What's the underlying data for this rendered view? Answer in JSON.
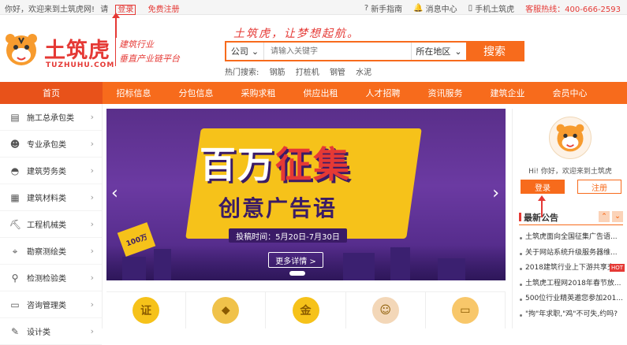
{
  "topbar": {
    "welcome": "你好，欢迎来到土筑虎网!",
    "please": "请",
    "login": "登录",
    "register": "免费注册",
    "guide": "新手指南",
    "messages": "消息中心",
    "mobile": "手机土筑虎",
    "hotline": "客服热线：400-666-2593"
  },
  "header": {
    "logo_text": "土筑虎",
    "logo_url": "TUZHUHU.COM",
    "slogan_line1": "建筑行业",
    "slogan_line2": "垂直产业链平台",
    "tagline": "土筑虎，让梦想起航。"
  },
  "search": {
    "type": "公司",
    "placeholder": "请输入关键字",
    "region": "所在地区",
    "button": "搜索",
    "hot_label": "热门搜索:",
    "hot_words": [
      "钢筋",
      "打桩机",
      "钢管",
      "水泥"
    ]
  },
  "nav": [
    "首页",
    "招标信息",
    "分包信息",
    "采购求租",
    "供应出租",
    "人才招聘",
    "资讯服务",
    "建筑企业",
    "会员中心"
  ],
  "sidebar": [
    {
      "label": "施工总承包类",
      "icon": "document-icon"
    },
    {
      "label": "专业承包类",
      "icon": "worker-icon"
    },
    {
      "label": "建筑劳务类",
      "icon": "helmet-icon"
    },
    {
      "label": "建筑材料类",
      "icon": "brick-icon"
    },
    {
      "label": "工程机械类",
      "icon": "excavator-icon"
    },
    {
      "label": "勘察测绘类",
      "icon": "survey-icon"
    },
    {
      "label": "检测检验类",
      "icon": "microscope-icon"
    },
    {
      "label": "咨询管理类",
      "icon": "chat-icon"
    },
    {
      "label": "设计类",
      "icon": "design-icon"
    }
  ],
  "banner": {
    "title_part1": "百万",
    "title_part2": "征集",
    "subtitle": "创意广告语",
    "time": "投稿时间：5月20日-7月30日",
    "more": "更多详情 >",
    "badge": "100万"
  },
  "features": [
    "证",
    "",
    "金",
    "",
    ""
  ],
  "user_panel": {
    "welcome": "Hi! 你好，欢迎来到土筑虎",
    "login": "登录",
    "register": "注册"
  },
  "notices": {
    "title": "最新公告",
    "items": [
      {
        "text": "土筑虎面向全国征集广告语...",
        "hot": false
      },
      {
        "text": "关于网站系统升级服务器维...",
        "hot": false
      },
      {
        "text": "2018建筑行业上下游共享交...",
        "hot": true
      },
      {
        "text": "土筑虎工程网2018年春节放...",
        "hot": false
      },
      {
        "text": "500位行业精英邀您参加201...",
        "hot": false
      },
      {
        "text": "\"拘\"年求职,\"鸡\"不可失,约吗?",
        "hot": false
      }
    ]
  },
  "colors": {
    "brand": "#f76b1c",
    "accent": "#e53935",
    "banner": "#5a2f8a",
    "yellow": "#f6c21a"
  }
}
